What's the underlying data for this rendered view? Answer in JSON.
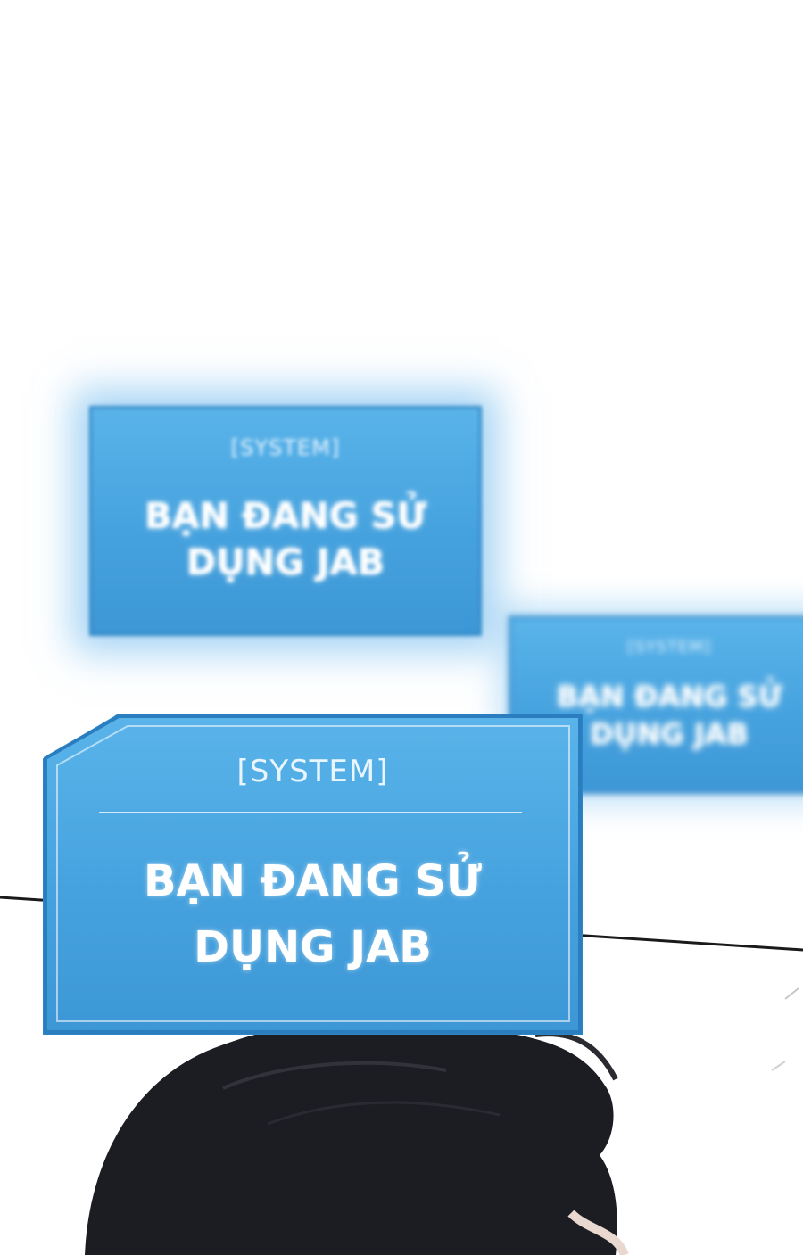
{
  "colors": {
    "panel_fill": "#46a2de",
    "panel_border": "#2f86c6",
    "panel_text": "#ffffff",
    "hair": "#1c1d22",
    "background": "#ffffff"
  },
  "panels": [
    {
      "tag": "[SYSTEM]",
      "message_line1": "BẠN ĐANG SỬ",
      "message_line2": "DỤNG JAB"
    },
    {
      "tag": "[SYSTEM]",
      "message_line1": "BẠN ĐANG SỬ",
      "message_line2": "DỤNG JAB"
    },
    {
      "tag": "[SYSTEM]",
      "message_line1": "BẠN ĐANG SỬ",
      "message_line2": "DỤNG JAB"
    }
  ]
}
